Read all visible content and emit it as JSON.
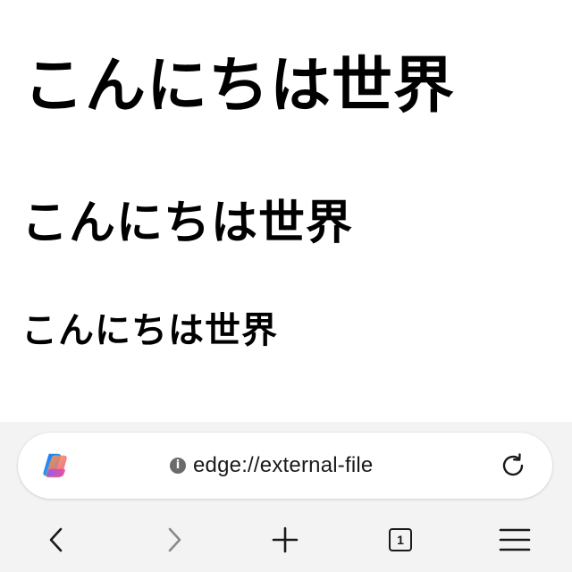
{
  "page": {
    "heading_1": "こんにちは世界",
    "heading_2": "こんにちは世界",
    "heading_3": "こんにちは世界"
  },
  "browser": {
    "address_bar": {
      "url": "edge://external-file",
      "info_icon": "i",
      "left_icon": "copilot-icon",
      "right_icon": "reload-icon"
    },
    "toolbar": {
      "back_icon": "chevron-left-icon",
      "forward_icon": "chevron-right-icon",
      "new_tab_icon": "plus-icon",
      "tab_count": "1",
      "menu_icon": "hamburger-menu-icon"
    },
    "colors": {
      "chrome_background": "#f3f3f3",
      "address_bar_background": "#ffffff",
      "forward_disabled": "#8a8a8a"
    }
  }
}
